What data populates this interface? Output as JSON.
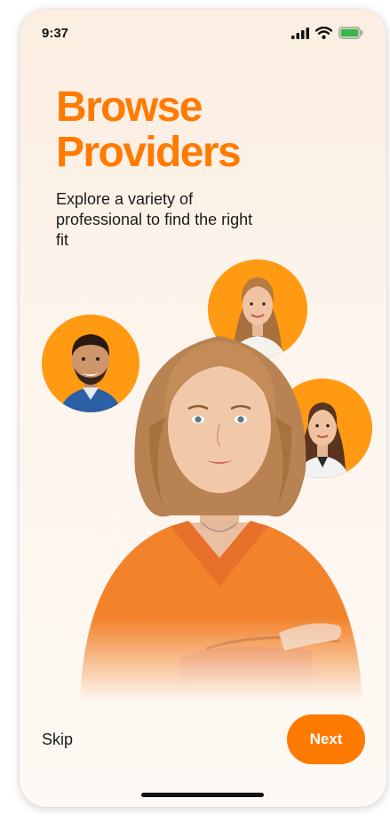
{
  "status_bar": {
    "time": "9:37",
    "icons": [
      "cellular-signal-icon",
      "wifi-icon",
      "battery-icon"
    ],
    "battery_color": "#3bb54a"
  },
  "onboarding": {
    "title_line1": "Browse",
    "title_line2": "Providers",
    "subtitle": "Explore a variety of professional to find the right fit",
    "accent_color": "#ff7a00"
  },
  "footer": {
    "skip_label": "Skip",
    "next_label": "Next"
  }
}
